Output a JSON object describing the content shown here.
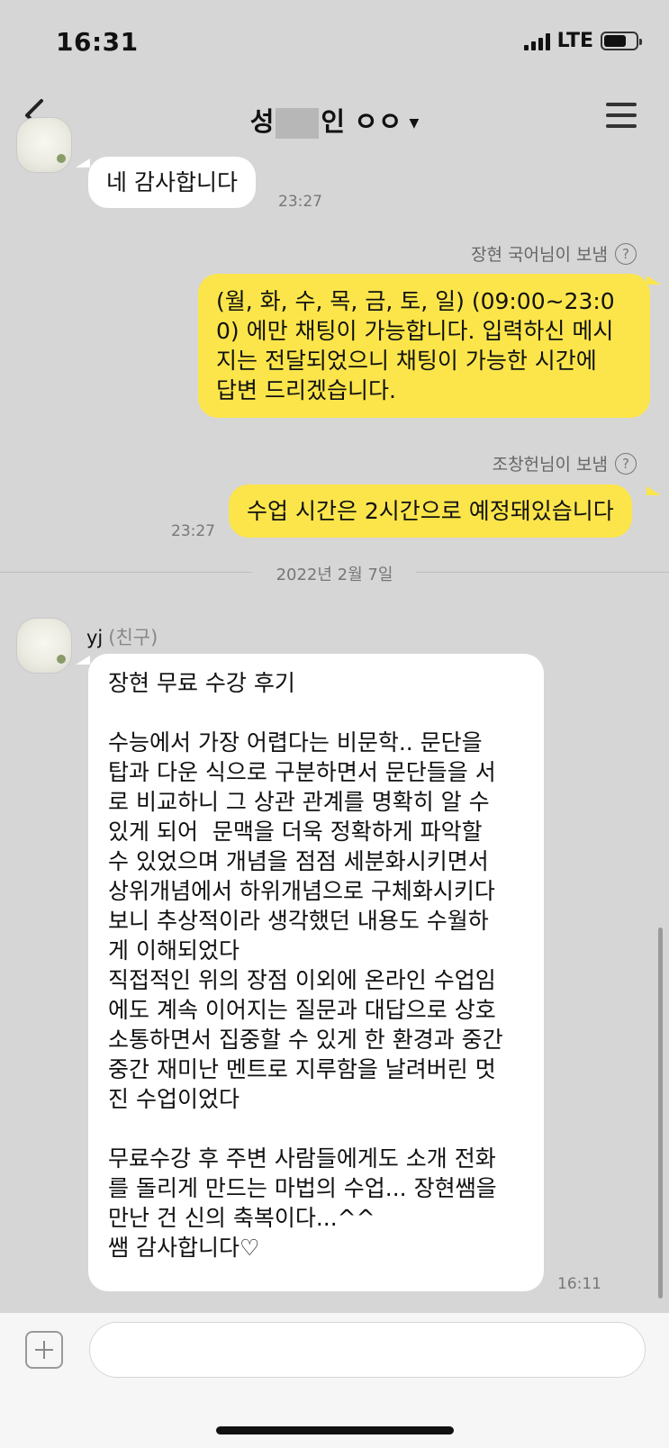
{
  "status_bar": {
    "time": "16:31",
    "network": "LTE",
    "battery_level": 0.72
  },
  "nav": {
    "title_prefix": "성",
    "title_suffix": "인 ㅇㅇ"
  },
  "messages": {
    "received_1": {
      "text": "네 감사합니다",
      "time": "23:27"
    },
    "sent_1": {
      "sender_note": "장현 국어님이 보냄",
      "text": "(월, 화, 수, 목, 금, 토, 일) (09:00~23:0\n0) 에만 채팅이 가능합니다. 입력하신 메시\n지는 전달되었으니 채팅이 가능한 시간에\n답변 드리겠습니다."
    },
    "sent_2": {
      "sender_note": "조창헌님이 보냄",
      "text": "수업 시간은 2시간으로 예정돼있습니다",
      "time": "23:27"
    },
    "date_divider": "2022년 2월 7일",
    "friend": {
      "name": "yj",
      "tag": "(친구)"
    },
    "received_2": {
      "text": "장현 무료 수강 후기\n\n수능에서 가장 어렵다는 비문학.. 문단을\n탑과 다운 식으로 구분하면서 문단들을 서\n로 비교하니 그 상관 관계를 명확히 알 수\n있게 되어  문맥을 더욱 정확하게 파악할\n수 있었으며 개념을 점점 세분화시키면서\n상위개념에서 하위개념으로 구체화시키다\n보니 추상적이라 생각했던 내용도 수월하\n게 이해되었다\n직접적인 위의 장점 이외에 온라인 수업임\n에도 계속 이어지는 질문과 대답으로 상호\n소통하면서 집중할 수 있게 한 환경과 중간\n중간 재미난 멘트로 지루함을 날려버린 멋\n진 수업이었다\n\n무료수강 후 주변 사람들에게도 소개 전화\n를 돌리게 만드는 마법의 수업... 장현쌤을\n만난 건 신의 축복이다...^^\n쌤 감사합니다♡",
      "time": "16:11"
    }
  },
  "input": {
    "value": "",
    "placeholder": ""
  },
  "colors": {
    "background": "#d6d6d6",
    "sent_bubble": "#fbe54b",
    "received_bubble": "#ffffff"
  },
  "icons": {
    "back": "chevron-left-icon",
    "menu": "hamburger-icon",
    "help": "question-circle-icon",
    "add": "plus-square-icon"
  }
}
